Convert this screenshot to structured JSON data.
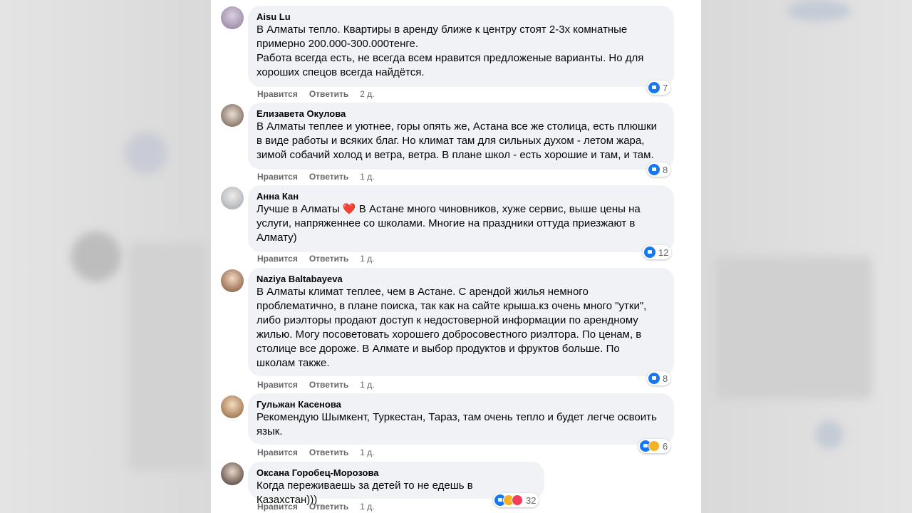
{
  "colors": {
    "bubble_bg": "#f0f2f5",
    "meta_text": "#65676b",
    "like_blue": "#1877f2",
    "heart_red": "#e41e3f"
  },
  "actions": {
    "like_label": "Нравится",
    "reply_label": "Ответить"
  },
  "comments": [
    {
      "author": "Aisu Lu",
      "text": "В Алматы тепло. Квартиры в аренду ближе к центру стоят 2-3х комнатные\nпримерно 200.000-300.000тенге.\nРабота всегда есть, не всегда всем нравится предложеные варианты. Но для\nхороших спецов всегда найдётся.",
      "time": "2 д.",
      "reactions": [
        "like"
      ],
      "reaction_count": "7"
    },
    {
      "author": "Елизавета Окулова",
      "text": "В Алматы теплее и уютнее, горы опять же, Астана все же столица, есть плюшки\nв виде работы и всяких благ. Но климат там для сильных духом - летом жара,\nзимой собачий холод и ветра, ветра. В плане школ - есть хорошие и там, и там.",
      "time": "1 д.",
      "reactions": [
        "like"
      ],
      "reaction_count": "8"
    },
    {
      "author": "Анна Кан",
      "text_before": "Лучше в Алматы ",
      "emoji": "❤️",
      "text_after": " В Астане много чиновников, хуже сервис, выше цены на\nуслуги, напряженнее со школами. Многие на праздники оттуда приезжают в\nАлмату)",
      "time": "1 д.",
      "reactions": [
        "like"
      ],
      "reaction_count": "12"
    },
    {
      "author": "Naziya Baltabayeva",
      "text": "В Алматы климат теплее, чем в Астане. С арендой жилья немного\nпроблематично, в плане поиска, так как на сайте крыша.кз очень много \"утки\",\nлибо риэлторы продают доступ к недостоверной информации по арендному\nжилью. Могу посоветовать хорошего добросовестного риэлтора. По ценам, в\nстолице все дороже. В Алмате и выбор продуктов и фруктов больше. По\nшколам также.",
      "time": "1 д.",
      "reactions": [
        "like"
      ],
      "reaction_count": "8"
    },
    {
      "author": "Гульжан Касенова",
      "text": "Рекомендую Шымкент, Туркестан, Тараз, там очень тепло и будет легче освоить\nязык.",
      "time": "1 д.",
      "reactions": [
        "like",
        "haha"
      ],
      "reaction_count": "6"
    },
    {
      "author": "Оксана Горобец-Морозова",
      "text": "Когда переживаешь за детей то не едешь в Казахстан)))",
      "time": "1 д.",
      "reactions": [
        "like",
        "haha",
        "love"
      ],
      "reaction_count": "32"
    }
  ]
}
